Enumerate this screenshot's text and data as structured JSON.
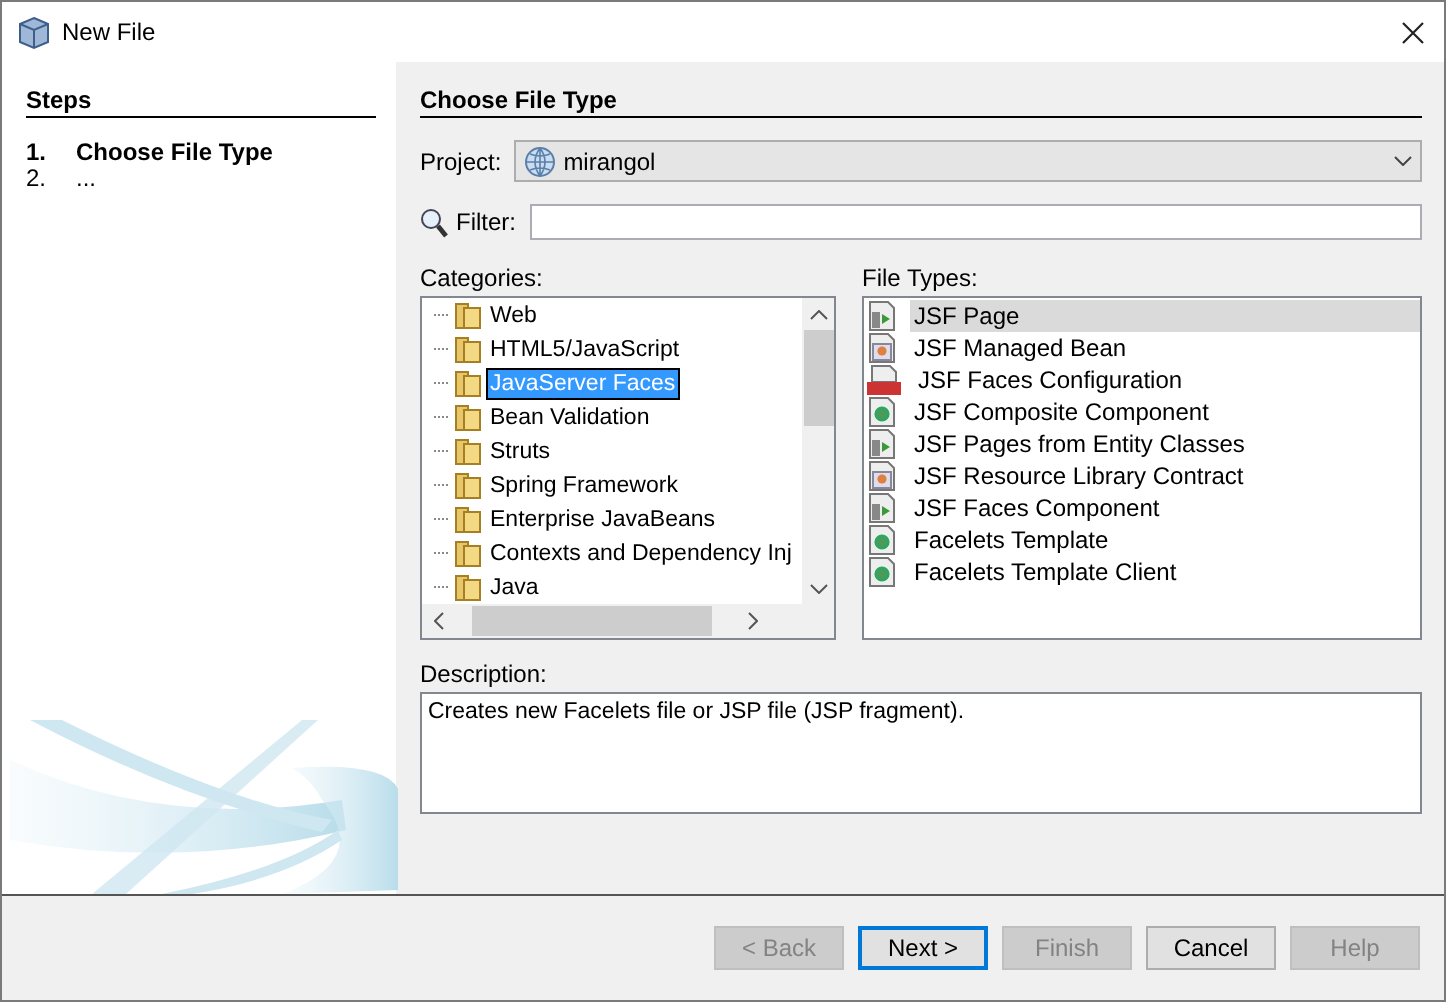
{
  "window": {
    "title": "New File"
  },
  "steps": {
    "heading": "Steps",
    "items": [
      {
        "number": "1.",
        "label": "Choose File Type",
        "selected": true
      },
      {
        "number": "2.",
        "label": "...",
        "selected": false
      }
    ]
  },
  "panel": {
    "heading": "Choose File Type"
  },
  "project": {
    "label": "Project:",
    "value": "mirangol"
  },
  "filter": {
    "label": "Filter:"
  },
  "categories": {
    "label": "Categories:",
    "items": [
      {
        "label": "Web",
        "selected": false
      },
      {
        "label": "HTML5/JavaScript",
        "selected": false
      },
      {
        "label": "JavaServer Faces",
        "selected": true
      },
      {
        "label": "Bean Validation",
        "selected": false
      },
      {
        "label": "Struts",
        "selected": false
      },
      {
        "label": "Spring Framework",
        "selected": false
      },
      {
        "label": "Enterprise JavaBeans",
        "selected": false
      },
      {
        "label": "Contexts and Dependency Inj",
        "selected": false
      },
      {
        "label": "Java",
        "selected": false
      }
    ]
  },
  "file_types": {
    "label": "File Types:",
    "items": [
      {
        "label": "JSF Page",
        "kind": "page",
        "selected": true
      },
      {
        "label": "JSF Managed Bean",
        "kind": "bean",
        "selected": false
      },
      {
        "label": "JSF Faces Configuration",
        "kind": "config",
        "selected": false
      },
      {
        "label": "JSF Composite Component",
        "kind": "component",
        "selected": false
      },
      {
        "label": "JSF Pages from Entity Classes",
        "kind": "page",
        "selected": false
      },
      {
        "label": "JSF Resource Library Contract",
        "kind": "bean",
        "selected": false
      },
      {
        "label": "JSF Faces Component",
        "kind": "page",
        "selected": false
      },
      {
        "label": "Facelets Template",
        "kind": "component",
        "selected": false
      },
      {
        "label": "Facelets Template Client",
        "kind": "component",
        "selected": false
      }
    ]
  },
  "description": {
    "label": "Description:",
    "text": "Creates new Facelets file or JSP file (JSP fragment)."
  },
  "buttons": [
    {
      "label": "< Back",
      "disabled": true,
      "default": false
    },
    {
      "label": "Next >",
      "disabled": false,
      "default": true
    },
    {
      "label": "Finish",
      "disabled": true,
      "default": false
    },
    {
      "label": "Cancel",
      "disabled": false,
      "default": false
    },
    {
      "label": "Help",
      "disabled": true,
      "default": false
    }
  ]
}
